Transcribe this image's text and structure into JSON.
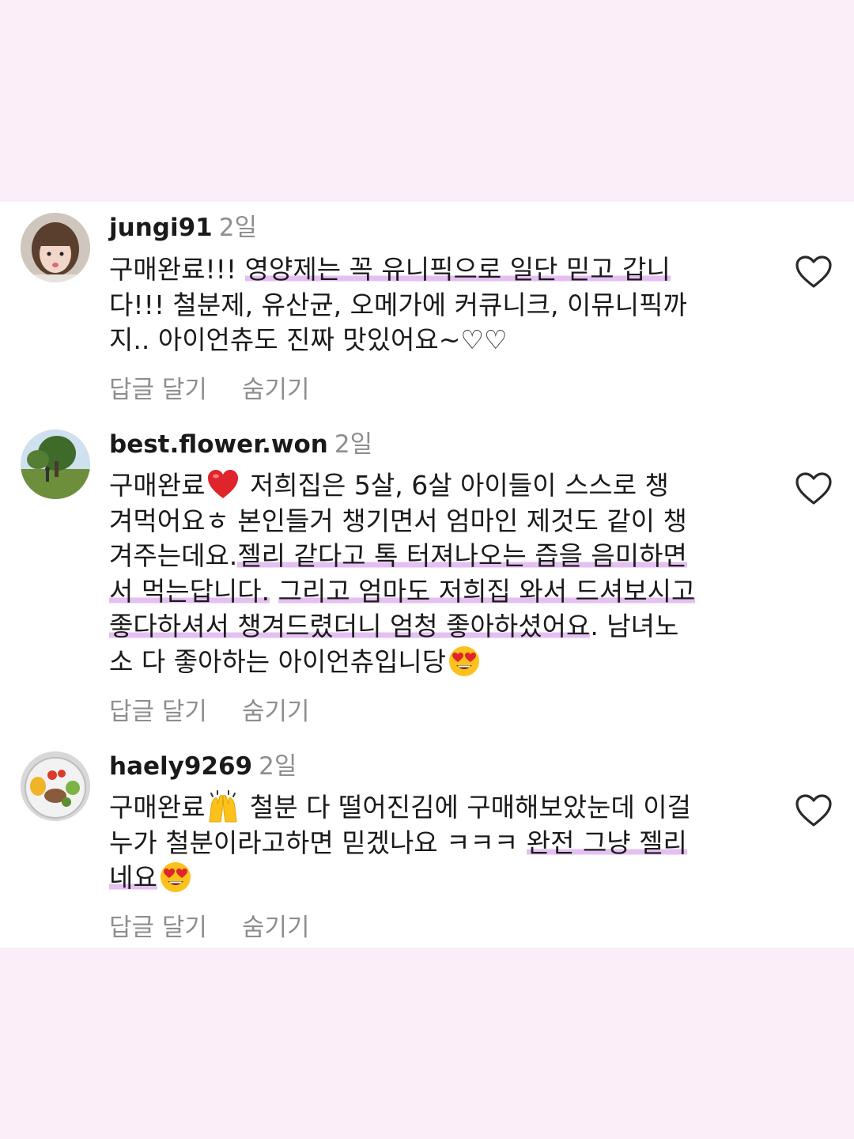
{
  "comments": [
    {
      "username": "jungi91",
      "time": "2일",
      "lines": [
        {
          "plain": "구매완료!!! ",
          "hl": "영양제는 꼭 유니픽으로 일단 믿고 갑니",
          "after": ""
        },
        {
          "plain": "다!!! 철분제, 유산균, 오메가에 커큐니크, 이뮤니픽까",
          "hl": "",
          "after": ""
        },
        {
          "plain": "지.. 아이언츄도 진짜 맛있어요~♡♡",
          "hl": "",
          "after": ""
        }
      ],
      "reply_label": "답글 달기",
      "hide_label": "숨기기",
      "avatar_icon": "profile-photo"
    },
    {
      "username": "best.flower.won",
      "time": "2일",
      "line1_a": "구매완료",
      "line1_b": " 저희집은 5살, 6살 아이들이 스스로 챙",
      "line2": "겨먹어요ㅎ 본인들거 챙기면서 엄마인 제것도 같이 챙",
      "line3_a": "겨주는데요.",
      "line3_hl": "젤리 같다고 톡 터져나오는 즙을 음미하면",
      "line4_hl_a": "서 먹는답니다.",
      "line4_b": " ",
      "line4_hl_b": "그리고 엄마도 저희집 와서 드셔보시고",
      "line5_hl": "좋다하셔서 챙겨드렸더니 엄청 좋아하셨어요",
      "line5_b": ". 남녀노",
      "line6": "소 다 좋아하는 아이언츄입니당",
      "reply_label": "답글 달기",
      "hide_label": "숨기기",
      "emojis": [
        "red-heart-emoji",
        "heart-eyes-emoji"
      ]
    },
    {
      "username": "haely9269",
      "time": "2일",
      "line1_a": "구매완료",
      "line1_b": " 철분 다 떨어진김에 구매해보았눈데 이걸",
      "line2_a": "누가 철분이라고하면 믿겠나요 ㅋㅋㅋ ",
      "line2_hl": "완전 그냥 젤리",
      "line3_hl": "네요",
      "reply_label": "답글 달기",
      "hide_label": "숨기기",
      "emojis": [
        "raising-hands-emoji",
        "heart-eyes-emoji"
      ]
    }
  ],
  "colors": {
    "background": "#fbeef8",
    "panel": "#ffffff",
    "highlight": "#e0b4f0",
    "muted_text": "#8e8e8e"
  }
}
